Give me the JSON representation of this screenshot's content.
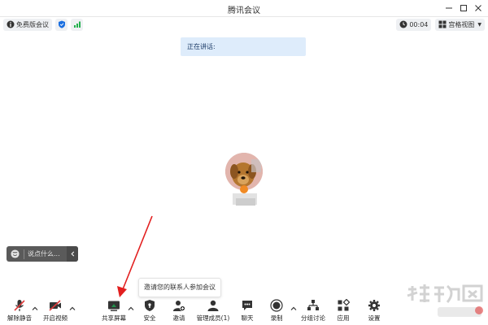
{
  "window": {
    "title": "腾讯会议"
  },
  "infobar": {
    "edition": "免费版会议",
    "timer": "00:04",
    "view_mode": "宫格视图"
  },
  "speaking": {
    "label": "正在讲话:"
  },
  "chat": {
    "placeholder": "说点什么..."
  },
  "tooltip": {
    "text": "邀请您的联系人参加会议"
  },
  "toolbar": {
    "unmute": "解除静音",
    "start_video": "开启视频",
    "share_screen": "共享屏幕",
    "security": "安全",
    "invite": "邀请",
    "manage_members": "管理成员(1)",
    "chat": "聊天",
    "record": "录制",
    "breakout": "分组讨论",
    "apps": "应用",
    "settings": "设置"
  },
  "colors": {
    "accent_blue": "#1b6fe0",
    "signal_green": "#22b14c",
    "mic_red": "#e03a3a",
    "share_green": "#1f8f4a",
    "arrow_red": "#e21f1f"
  },
  "icons": [
    "info-icon",
    "shield-icon",
    "signal-icon",
    "clock-icon",
    "grid-view-icon",
    "minimize-icon",
    "maximize-icon",
    "close-icon",
    "mic-muted-icon",
    "video-off-icon",
    "share-screen-icon",
    "security-shield-icon",
    "invite-icon",
    "members-icon",
    "chat-icon",
    "record-icon",
    "breakout-icon",
    "apps-icon",
    "settings-gear-icon"
  ]
}
